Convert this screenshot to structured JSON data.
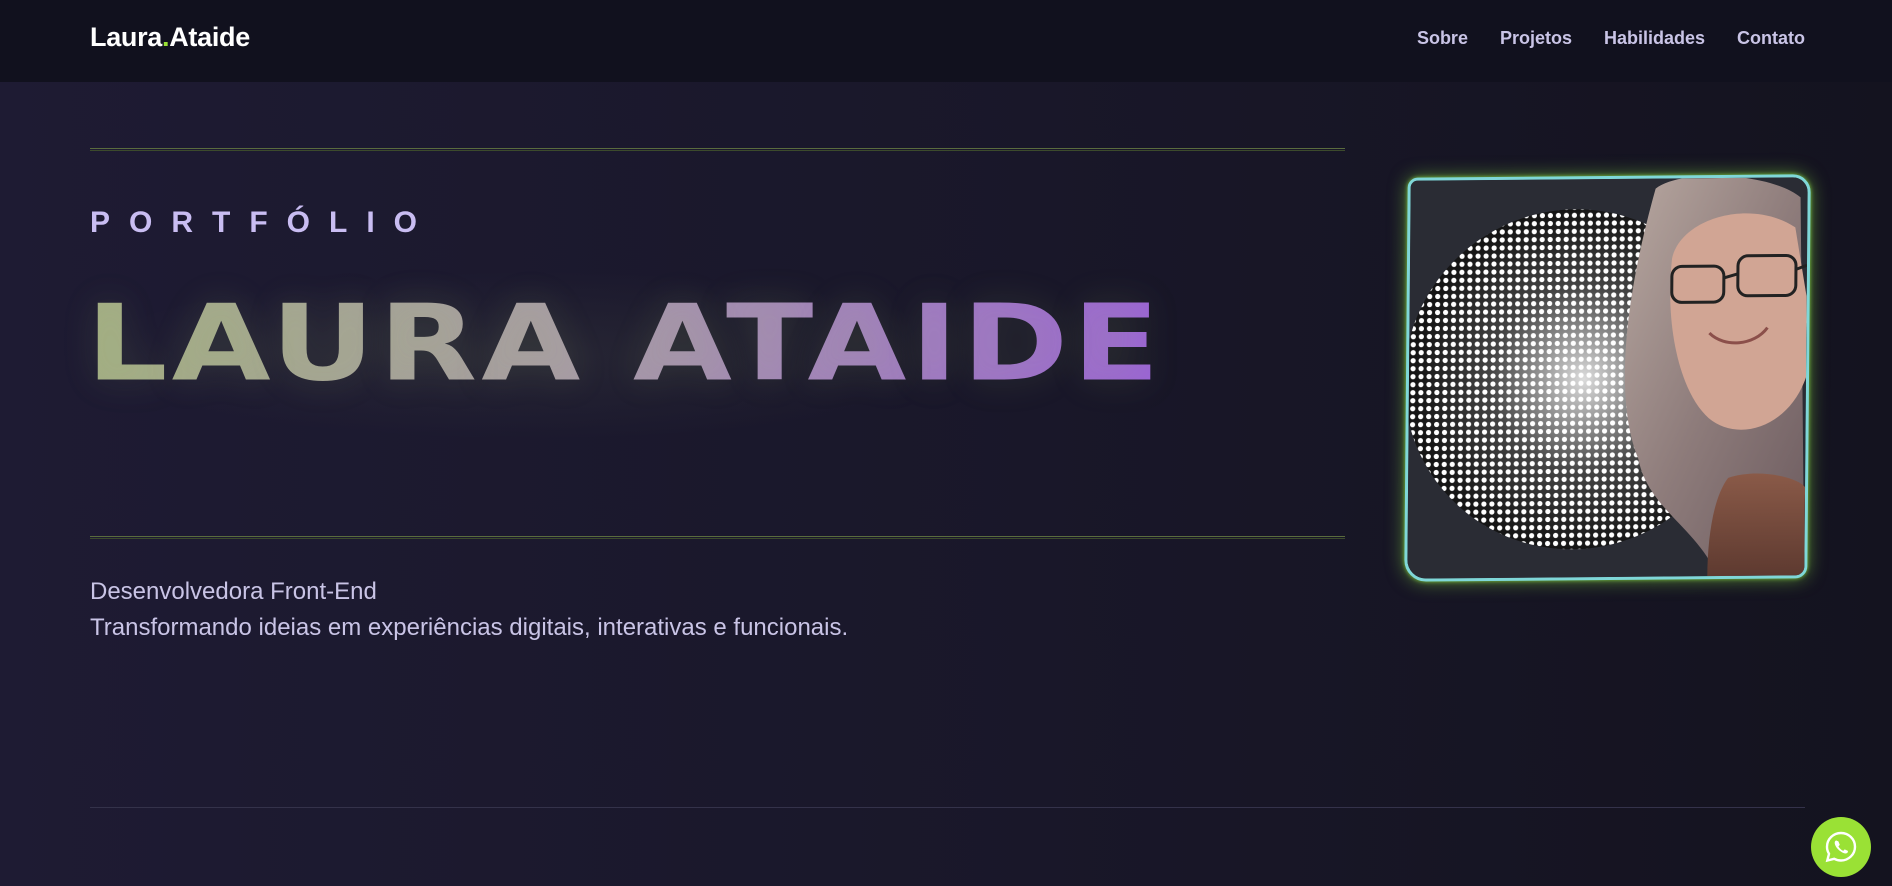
{
  "header": {
    "logo_first": "Laura",
    "logo_dot": ".",
    "logo_last": "Ataide",
    "nav": [
      {
        "label": "Sobre"
      },
      {
        "label": "Projetos"
      },
      {
        "label": "Habilidades"
      },
      {
        "label": "Contato"
      }
    ]
  },
  "hero": {
    "eyebrow": "PORTFÓLIO",
    "name": "LAURA ATAIDE",
    "role_line1": "Desenvolvedora Front-End",
    "role_line2": "Transformando ideias em experiências digitais, interativas e funcionais."
  },
  "photo": {
    "icon": "profile-photo"
  },
  "whatsapp": {
    "icon": "whatsapp-icon"
  },
  "colors": {
    "accent_green": "#9ae135",
    "accent_purple": "#9a62d6",
    "photo_border": "#7fd7d8",
    "background": "#1b1a2d"
  }
}
